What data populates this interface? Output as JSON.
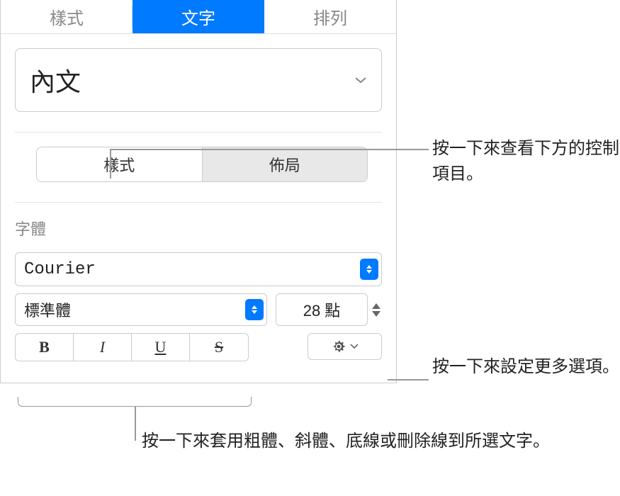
{
  "topTabs": {
    "style": "樣式",
    "text": "文字",
    "arrange": "排列"
  },
  "paragraphStyle": "內文",
  "segTabs": {
    "style": "樣式",
    "layout": "佈局"
  },
  "fontSection": {
    "label": "字體",
    "fontName": "Courier",
    "weight": "標準體",
    "size": "28 點"
  },
  "callouts": {
    "segHint": "按一下來查看下方的控制項目。",
    "gearHint": "按一下來設定更多選項。",
    "fmtHint": "按一下來套用粗體、斜體、底線或刪除線到所選文字。"
  }
}
